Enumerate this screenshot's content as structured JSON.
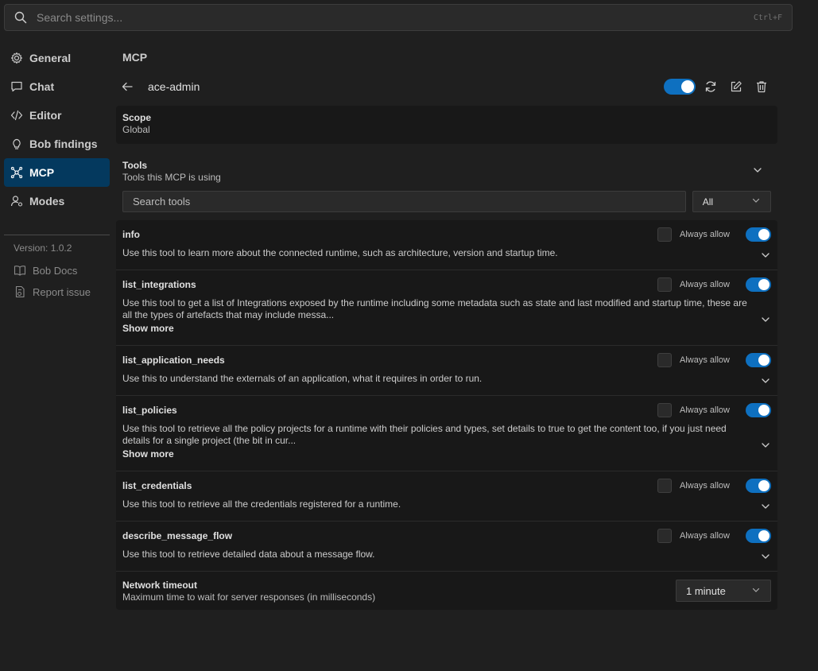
{
  "search": {
    "placeholder": "Search settings...",
    "shortcut": "Ctrl+F"
  },
  "sidebar": {
    "items": [
      {
        "label": "General",
        "icon": "gear-icon"
      },
      {
        "label": "Chat",
        "icon": "chat-icon"
      },
      {
        "label": "Editor",
        "icon": "code-icon"
      },
      {
        "label": "Bob findings",
        "icon": "lightbulb-icon"
      },
      {
        "label": "MCP",
        "icon": "mcp-icon",
        "active": true
      },
      {
        "label": "Modes",
        "icon": "person-icon"
      }
    ],
    "version": "Version: 1.0.2",
    "links": [
      {
        "label": "Bob Docs",
        "icon": "book-icon"
      },
      {
        "label": "Report issue",
        "icon": "report-icon"
      }
    ]
  },
  "main": {
    "section_title": "MCP",
    "server": {
      "name": "ace-admin",
      "enabled": true
    },
    "scope": {
      "label": "Scope",
      "value": "Global"
    },
    "tools": {
      "title": "Tools",
      "subtitle": "Tools this MCP is using",
      "search_placeholder": "Search tools",
      "filter_value": "All",
      "always_allow_label": "Always allow",
      "show_more_label": "Show more",
      "items": [
        {
          "name": "info",
          "desc": "Use this tool to learn more about the connected runtime, such as architecture, version and startup time."
        },
        {
          "name": "list_integrations",
          "desc": "Use this tool to get a list of Integrations exposed by the runtime including some metadata such as state and last modified and startup time, these are all the types of artefacts that may include messa..."
        },
        {
          "name": "list_application_needs",
          "desc": "Use this to understand the externals of an application, what it requires in order to run."
        },
        {
          "name": "list_policies",
          "desc": "Use this tool to retrieve all the policy projects for a runtime with their policies and types, set details to true to get the content too, if you just need details for a single project (the bit in cur..."
        },
        {
          "name": "list_credentials",
          "desc": "Use this tool to retrieve all the credentials registered for a runtime."
        },
        {
          "name": "describe_message_flow",
          "desc": "Use this tool to retrieve detailed data about a message flow."
        }
      ]
    },
    "timeout": {
      "label": "Network timeout",
      "desc": "Maximum time to wait for server responses (in milliseconds)",
      "value": "1 minute"
    }
  },
  "colors": {
    "accent": "#0e70c0",
    "active_nav": "#04395e",
    "background": "#1f1f1f",
    "card": "#181818"
  }
}
